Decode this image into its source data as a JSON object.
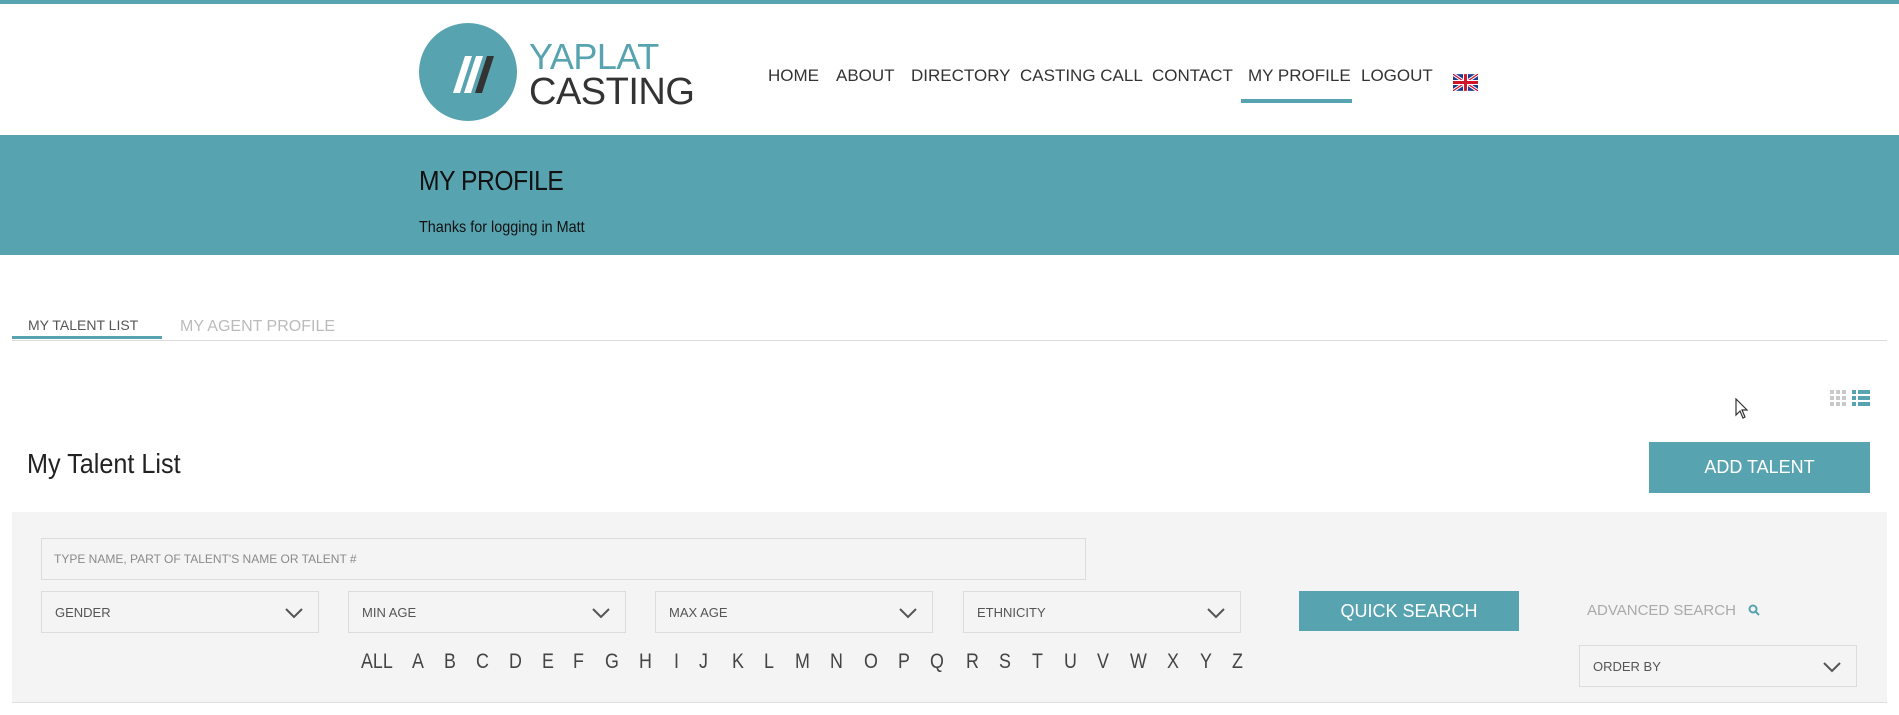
{
  "logo": {
    "line1": "YAPLAT",
    "line2": "CASTING"
  },
  "nav": {
    "items": [
      {
        "label": "HOME"
      },
      {
        "label": "ABOUT"
      },
      {
        "label": "DIRECTORY"
      },
      {
        "label": "CASTING CALL"
      },
      {
        "label": "CONTACT"
      },
      {
        "label": "MY PROFILE"
      },
      {
        "label": "LOGOUT"
      }
    ],
    "active": "MY PROFILE",
    "language_icon": "uk-flag-icon"
  },
  "banner": {
    "title": "MY PROFILE",
    "subtitle": "Thanks for logging in Matt"
  },
  "tabs": [
    {
      "label": "MY TALENT LIST"
    },
    {
      "label": "MY AGENT PROFILE"
    }
  ],
  "talent": {
    "title": "My Talent List",
    "add_button": "ADD TALENT"
  },
  "search": {
    "placeholder": "TYPE NAME, PART OF TALENT'S NAME OR TALENT #",
    "gender": "GENDER",
    "min_age": "MIN AGE",
    "max_age": "MAX AGE",
    "ethnicity": "ETHNICITY",
    "quick_search": "QUICK SEARCH",
    "advanced_search": "ADVANCED SEARCH",
    "order_by": "ORDER BY"
  },
  "alphabet": [
    "ALL",
    "A",
    "B",
    "C",
    "D",
    "E",
    "F",
    "G",
    "H",
    "I",
    "J",
    "K",
    "L",
    "M",
    "N",
    "O",
    "P",
    "Q",
    "R",
    "S",
    "T",
    "U",
    "V",
    "W",
    "X",
    "Y",
    "Z"
  ],
  "colors": {
    "accent": "#57a3b0",
    "panel": "#f4f4f4"
  }
}
